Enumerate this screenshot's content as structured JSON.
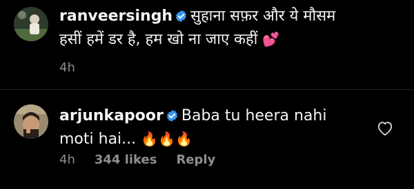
{
  "caption": {
    "username": "ranveersingh",
    "text": "सुहाना सफ़र और ये मौसम हसीं हमें डर है, हम खो ना जाए कहीं",
    "emoji": "💕",
    "time": "4h"
  },
  "comment": {
    "username": "arjunkapoor",
    "text": "Baba tu heera nahi moti hai...",
    "emoji": "🔥🔥🔥",
    "time": "4h",
    "likes": "344 likes",
    "reply_label": "Reply"
  },
  "icons": {
    "verified": "verified-badge-icon",
    "like": "heart-outline-icon"
  },
  "colors": {
    "background": "#000000",
    "verified": "#3897f0",
    "meta": "#8e8e8e"
  }
}
